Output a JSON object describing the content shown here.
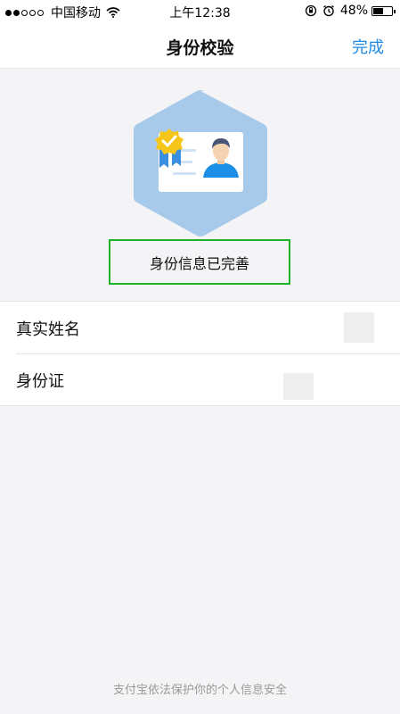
{
  "status_bar": {
    "carrier": "中国移动",
    "time": "上午12:38",
    "battery_percent": "48%",
    "battery_level": 0.48
  },
  "nav": {
    "title": "身份校验",
    "done_label": "完成"
  },
  "verification": {
    "status_text": "身份信息已完善"
  },
  "form": {
    "rows": [
      {
        "label": "真实姓名"
      },
      {
        "label": "身份证"
      }
    ]
  },
  "footer": {
    "note": "支付宝依法保护你的个人信息安全"
  },
  "colors": {
    "accent": "#1f8be6",
    "hexagon": "#a7c9ea",
    "highlight_border": "#1fb12a",
    "badge": "#f5c518"
  }
}
